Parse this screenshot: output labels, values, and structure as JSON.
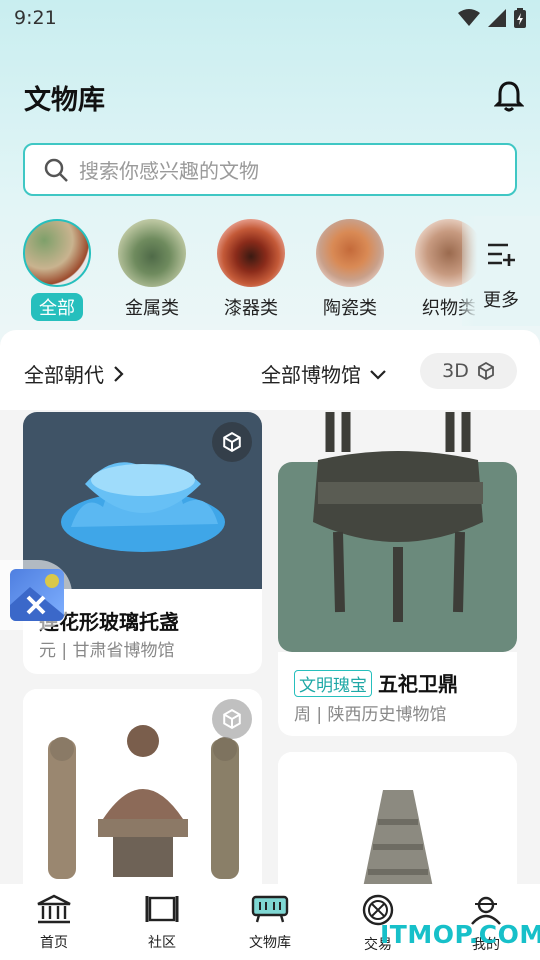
{
  "status": {
    "time": "9:21"
  },
  "header": {
    "title": "文物库",
    "bell_icon": "bell-icon"
  },
  "search": {
    "placeholder": "搜索你感兴趣的文物"
  },
  "categories": [
    {
      "label": "全部",
      "active": true
    },
    {
      "label": "金属类",
      "active": false
    },
    {
      "label": "漆器类",
      "active": false
    },
    {
      "label": "陶瓷类",
      "active": false
    },
    {
      "label": "织物类",
      "active": false
    }
  ],
  "more_label": "更多",
  "filters": {
    "dynasty": "全部朝代",
    "museum": "全部博物馆",
    "three_d": "3D"
  },
  "cards": [
    {
      "title": "莲花形玻璃托盏",
      "sub": "元 | 甘肃省博物馆",
      "has3d": true
    },
    {
      "tag": "文明瑰宝",
      "title": "五祀卫鼎",
      "sub": "周 | 陕西历史博物馆",
      "has3d": false
    },
    {
      "title": "",
      "sub": "",
      "has3d": true
    },
    {
      "title": "",
      "sub": "",
      "has3d": false
    }
  ],
  "tabs": [
    {
      "label": "首页",
      "icon": "museum-icon"
    },
    {
      "label": "社区",
      "icon": "scroll-icon"
    },
    {
      "label": "文物库",
      "icon": "cauldron-icon",
      "active": true
    },
    {
      "label": "交易",
      "icon": "coin-icon"
    },
    {
      "label": "我的",
      "icon": "profile-icon"
    }
  ],
  "watermark": "ITMOP.COM"
}
